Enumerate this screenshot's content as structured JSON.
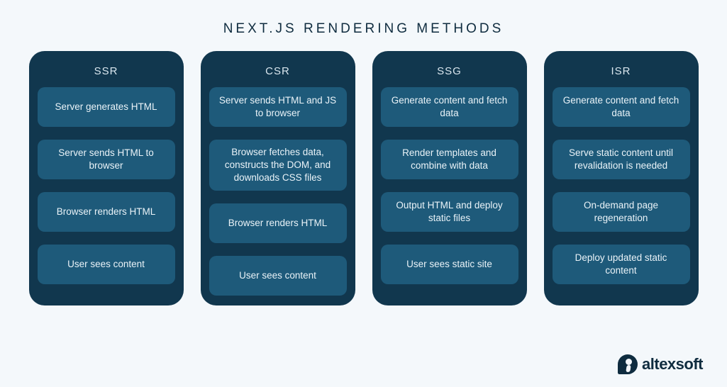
{
  "title": "NEXT.JS RENDERING METHODS",
  "columns": [
    {
      "name": "SSR",
      "steps": [
        "Server generates HTML",
        "Server sends HTML to browser",
        "Browser renders HTML",
        "User sees content"
      ]
    },
    {
      "name": "CSR",
      "steps": [
        "Server sends HTML and JS to browser",
        "Browser fetches data, constructs the DOM, and downloads CSS files",
        "Browser renders HTML",
        "User sees content"
      ]
    },
    {
      "name": "SSG",
      "steps": [
        "Generate content and fetch data",
        "Render templates and combine with data",
        "Output HTML and deploy static files",
        "User sees static site"
      ]
    },
    {
      "name": "ISR",
      "steps": [
        "Generate content and fetch data",
        "Serve static content until revalidation is needed",
        "On-demand page regeneration",
        "Deploy updated static content"
      ]
    }
  ],
  "branding": {
    "name": "altexsoft"
  },
  "colors": {
    "page_bg": "#f4f8fb",
    "column_bg": "#11374e",
    "step_bg": "#1e5a7a",
    "text_dark": "#0f2c3f",
    "text_light": "#eaf3f8"
  }
}
